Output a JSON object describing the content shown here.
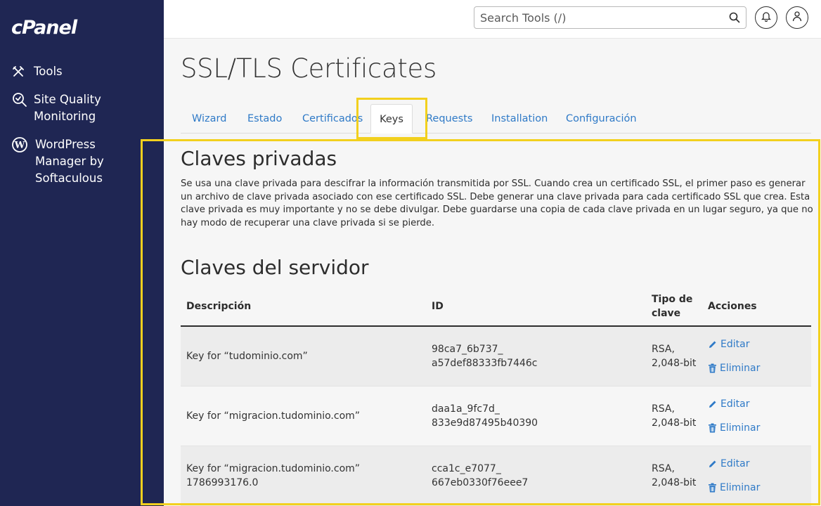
{
  "brand": {
    "logo": "cPanel"
  },
  "sidebar": {
    "items": [
      {
        "label": "Tools",
        "icon": "tools-icon"
      },
      {
        "label": "Site Quality Monitoring",
        "icon": "site-quality-icon"
      },
      {
        "label": "WordPress Manager by Softaculous",
        "icon": "wordpress-icon"
      }
    ]
  },
  "header": {
    "search_placeholder": "Search Tools (/)",
    "icons": [
      "search-icon",
      "bell-icon",
      "user-icon"
    ]
  },
  "page": {
    "title": "SSL/TLS Certificates",
    "tabs": [
      {
        "label": "Wizard"
      },
      {
        "label": "Estado"
      },
      {
        "label": "Certificados"
      },
      {
        "label": "Keys",
        "active": true
      },
      {
        "label": "Requests"
      },
      {
        "label": "Installation"
      },
      {
        "label": "Configuración"
      }
    ]
  },
  "private_keys": {
    "heading": "Claves privadas",
    "description": "Se usa una clave privada para descifrar la información transmitida por SSL. Cuando crea un certificado SSL, el primer paso es generar un archivo de clave privada asociado con ese certificado SSL. Debe generar una clave privada para cada certificado SSL que crea. Esta clave privada es muy importante y no se debe divulgar. Debe guardarse una copia de cada clave privada en un lugar seguro, ya que no hay modo de recuperar una clave privada si se pierde."
  },
  "server_keys": {
    "heading": "Claves del servidor",
    "columns": {
      "description": "Descripción",
      "id": "ID",
      "key_type": "Tipo de clave",
      "actions": "Acciones"
    },
    "rows": [
      {
        "description": "Key for “tudominio.com”",
        "id_line1": "98ca7_6b737_",
        "id_line2": "a57def88333fb7446c",
        "type_line1": "RSA,",
        "type_line2": "2,048-bit",
        "edit": "Editar",
        "delete": "Eliminar"
      },
      {
        "description": "Key for “migracion.tudominio.com”",
        "id_line1": "daa1a_9fc7d_",
        "id_line2": "833e9d87495b40390",
        "type_line1": "RSA,",
        "type_line2": "2,048-bit",
        "edit": "Editar",
        "delete": "Eliminar"
      },
      {
        "description": "Key for “migracion.tudominio.com” 1786993176.0",
        "id_line1": "cca1c_e7077_",
        "id_line2": "667eb0330f76eee7",
        "type_line1": "RSA,",
        "type_line2": "2,048-bit",
        "edit": "Editar",
        "delete": "Eliminar"
      }
    ]
  },
  "colors": {
    "sidebar_bg": "#1f2653",
    "link": "#2f7ac7",
    "highlight": "#f2d01e"
  }
}
